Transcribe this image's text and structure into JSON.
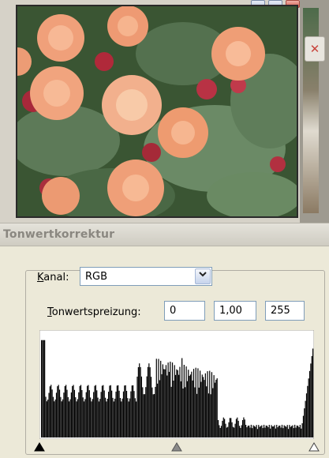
{
  "dialog": {
    "title": "Tonwertkorrektur",
    "channel": {
      "label_accel": "K",
      "label_rest": "anal:",
      "selected": "RGB"
    },
    "input_levels": {
      "label_accel": "T",
      "label_rest": "onwertspreizung:",
      "black": "0",
      "gamma": "1,00",
      "white": "255"
    },
    "slider_levels": {
      "black": 0,
      "gamma": 0.5,
      "white": 1
    }
  },
  "icons": {
    "dropdown": "chevron-down-icon",
    "close": "close-icon",
    "black_point": "black-triangle-icon",
    "gray_point": "gray-triangle-icon",
    "white_point": "white-triangle-icon"
  }
}
